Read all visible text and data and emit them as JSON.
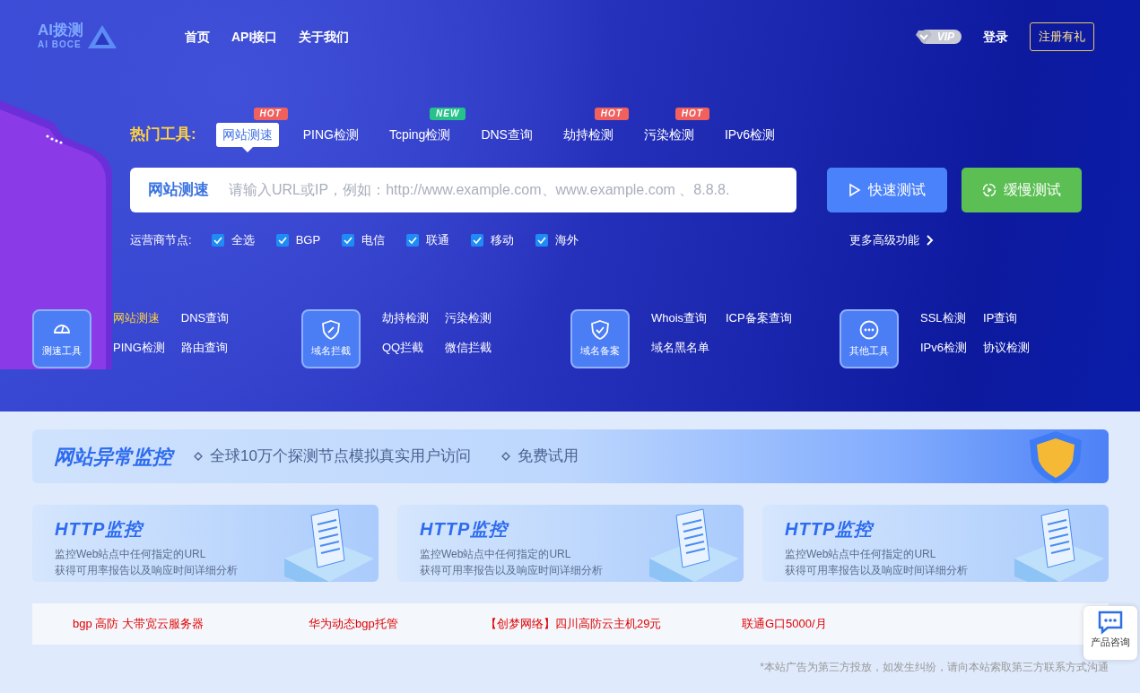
{
  "logo": {
    "title": "AI拨测",
    "subtitle": "AI BOCE"
  },
  "nav": [
    "首页",
    "API接口",
    "关于我们"
  ],
  "account": {
    "vip": "VIP",
    "login": "登录",
    "register": "注册有礼"
  },
  "hot_tools": {
    "label": "热门工具:",
    "tabs": [
      {
        "label": "网站测速",
        "selected": true,
        "badge": {
          "text": "HOT",
          "kind": "hot"
        }
      },
      {
        "label": "PING检测",
        "selected": false
      },
      {
        "label": "Tcping检测",
        "selected": false,
        "badge": {
          "text": "NEW",
          "kind": "new"
        }
      },
      {
        "label": "DNS查询",
        "selected": false
      },
      {
        "label": "劫持检测",
        "selected": false,
        "badge": {
          "text": "HOT",
          "kind": "hot"
        }
      },
      {
        "label": "污染检测",
        "selected": false,
        "badge": {
          "text": "HOT",
          "kind": "hot"
        }
      },
      {
        "label": "IPv6检测",
        "selected": false
      }
    ]
  },
  "search": {
    "label": "网站测速",
    "placeholder": "请输入URL或IP，例如：http://www.example.com、www.example.com 、8.8.8."
  },
  "buttons": [
    {
      "label": "快速测试",
      "kind": "fast"
    },
    {
      "label": "缓慢测试",
      "kind": "slow"
    }
  ],
  "nodes": {
    "label": "运营商节点:",
    "options": [
      {
        "label": "全选",
        "checked": true
      },
      {
        "label": "BGP",
        "checked": true
      },
      {
        "label": "电信",
        "checked": true
      },
      {
        "label": "联通",
        "checked": true
      },
      {
        "label": "移动",
        "checked": true
      },
      {
        "label": "海外",
        "checked": true
      }
    ]
  },
  "more_link": "更多高级功能",
  "categories": [
    {
      "name": "测速工具",
      "kind": "gauge",
      "links": [
        {
          "label": "网站测速",
          "selected": true
        },
        {
          "label": "DNS查询",
          "selected": false
        },
        {
          "label": "PING检测",
          "selected": false
        },
        {
          "label": "路由查询",
          "selected": false
        }
      ]
    },
    {
      "name": "域名拦截",
      "kind": "shield-slash",
      "links": [
        {
          "label": "劫持检测",
          "selected": false
        },
        {
          "label": "污染检测",
          "selected": false
        },
        {
          "label": "QQ拦截",
          "selected": false
        },
        {
          "label": "微信拦截",
          "selected": false
        }
      ]
    },
    {
      "name": "域名备案",
      "kind": "shield-check",
      "links": [
        {
          "label": "Whois查询",
          "selected": false
        },
        {
          "label": "ICP备案查询",
          "selected": false
        },
        {
          "label": "域名黑名单",
          "selected": false
        }
      ]
    },
    {
      "name": "其他工具",
      "kind": "dots",
      "links": [
        {
          "label": "SSL检测",
          "selected": false
        },
        {
          "label": "IP查询",
          "selected": false
        },
        {
          "label": "IPv6检测",
          "selected": false
        },
        {
          "label": "协议检测",
          "selected": false
        }
      ]
    }
  ],
  "banner": {
    "title": "网站异常监控",
    "points": [
      "全球10万个探测节点模拟真实用户访问",
      "免费试用"
    ]
  },
  "cards": [
    {
      "title": "HTTP监控",
      "lines": [
        "监控Web站点中任何指定的URL",
        "获得可用率报告以及响应时间详细分析"
      ]
    },
    {
      "title": "HTTP监控",
      "lines": [
        "监控Web站点中任何指定的URL",
        "获得可用率报告以及响应时间详细分析"
      ]
    },
    {
      "title": "HTTP监控",
      "lines": [
        "监控Web站点中任何指定的URL",
        "获得可用率报告以及响应时间详细分析"
      ]
    }
  ],
  "ads": [
    "bgp 高防 大带宽云服务器",
    "华为动态bgp托管",
    "【创梦网络】四川高防云主机29元",
    "联通G口5000/月"
  ],
  "disclaimer": "*本站广告为第三方投放，如发生纠纷，请向本站索取第三方联系方式沟通",
  "consult": "产品咨询"
}
